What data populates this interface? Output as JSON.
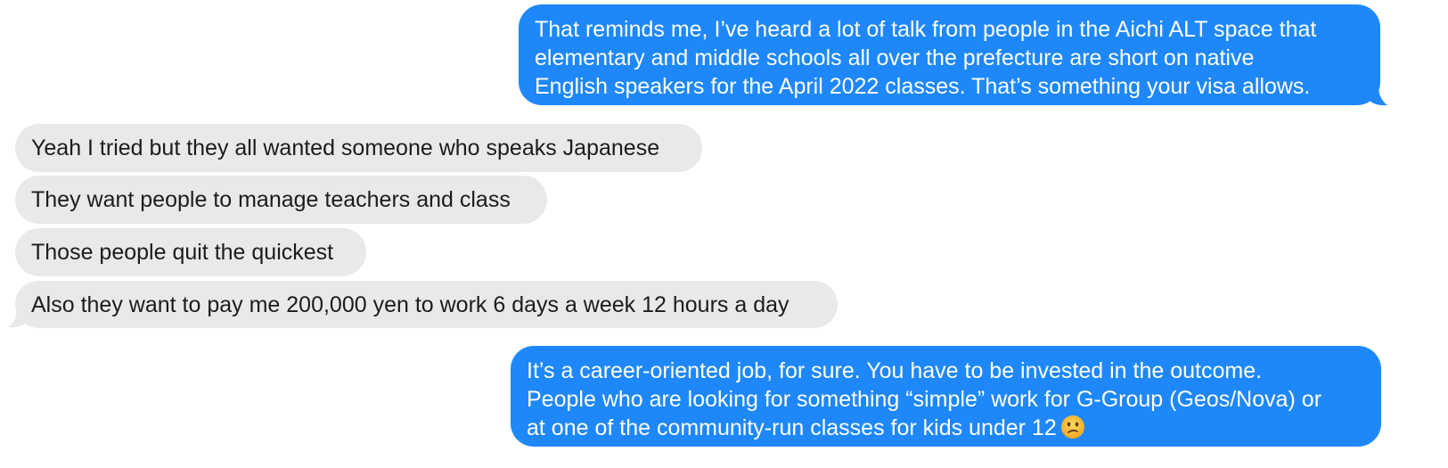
{
  "conversation": {
    "messages": [
      {
        "direction": "outgoing",
        "lines": [
          "That reminds me, I’ve heard a lot of talk from people in the Aichi ALT space that",
          "elementary and middle schools all over the prefecture are short on native",
          "English speakers for the April 2022 classes. That’s something your visa allows."
        ]
      },
      {
        "direction": "incoming",
        "text": "Yeah I tried but they all wanted someone who speaks Japanese"
      },
      {
        "direction": "incoming",
        "text": "They want people to manage teachers and class"
      },
      {
        "direction": "incoming",
        "text": "Those people quit the quickest"
      },
      {
        "direction": "incoming",
        "text": "Also they want to pay me 200,000 yen to work 6 days a week 12 hours a day"
      },
      {
        "direction": "outgoing",
        "lines": [
          "It’s a career-oriented job, for sure. You have to be invested in the outcome.",
          "People who are looking for something “simple” work for G-Group (Geos/Nova) or",
          "at one of the community-run classes for kids under 12"
        ],
        "emoji": "confused-face-icon"
      }
    ]
  },
  "colors": {
    "sent_bubble": "#1e88fa",
    "received_bubble": "#e9e9eb",
    "sent_text": "#ffffff",
    "received_text": "#1c1c1e"
  }
}
